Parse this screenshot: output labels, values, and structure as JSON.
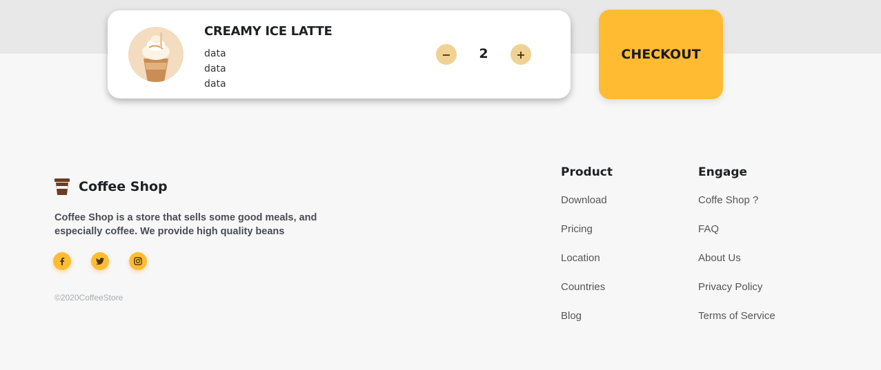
{
  "cart": {
    "product_name": "CREAMY ICE LATTE",
    "details": [
      "data",
      "data",
      "data"
    ],
    "quantity": "2",
    "minus_label": "−",
    "plus_label": "+"
  },
  "checkout": {
    "label": "CHECKOUT"
  },
  "footer": {
    "brand_name": "Coffee Shop",
    "description": "Coffee Shop is a store that sells some good meals, and especially coffee. We provide high quality beans",
    "copyright": "©2020CoffeeStore",
    "social": [
      {
        "icon": "facebook-icon"
      },
      {
        "icon": "twitter-icon"
      },
      {
        "icon": "instagram-icon"
      }
    ],
    "columns": [
      {
        "heading": "Product",
        "links": [
          "Download",
          "Pricing",
          "Location",
          "Countries",
          "Blog"
        ]
      },
      {
        "heading": "Engage",
        "links": [
          "Coffe Shop ?",
          "FAQ",
          "About Us",
          "Privacy Policy",
          "Terms of Service"
        ]
      }
    ]
  },
  "colors": {
    "accent": "#ffbc33",
    "qty_button": "#f0d294",
    "brand_icon": "#6b3d24",
    "top_band": "#e8e8e8",
    "page_bg": "#f7f7f7"
  }
}
